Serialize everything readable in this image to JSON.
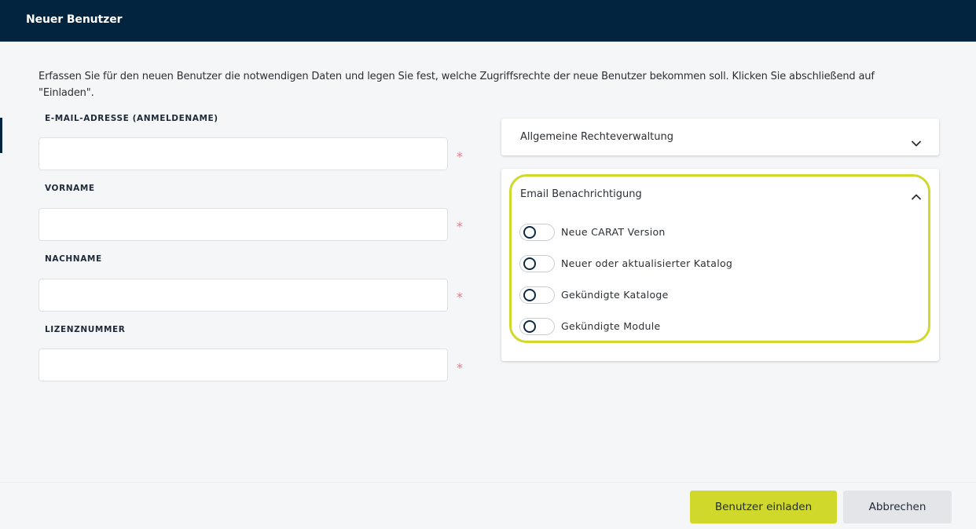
{
  "dialog": {
    "title": "Neuer Benutzer",
    "intro": "Erfassen Sie für den neuen Benutzer die notwendigen Daten und legen Sie fest, welche Zugriffsrechte der neue Benutzer bekommen soll. Klicken Sie abschließend auf \"Einladen\"."
  },
  "form": {
    "required_mark": "*",
    "email": {
      "label": "E-MAIL-ADRESSE (ANMELDENAME)",
      "value": ""
    },
    "firstname": {
      "label": "VORNAME",
      "value": ""
    },
    "lastname": {
      "label": "NACHNAME",
      "value": ""
    },
    "license": {
      "label": "LIZENZNUMMER",
      "value": ""
    }
  },
  "panels": {
    "general": {
      "title": "Allgemeine Rechteverwaltung",
      "expanded": false,
      "icon": "chevron-down-icon"
    },
    "email": {
      "title": "Email Benachrichtigung",
      "expanded": true,
      "icon": "chevron-up-icon",
      "highlight_color": "#cfd82b",
      "toggles": [
        {
          "label": "Neue CARAT Version",
          "on": false
        },
        {
          "label": "Neuer oder aktualisierter Katalog",
          "on": false
        },
        {
          "label": "Gekündigte Kataloge",
          "on": false
        },
        {
          "label": "Gekündigte Module",
          "on": false
        }
      ]
    }
  },
  "footer": {
    "invite_label": "Benutzer einladen",
    "cancel_label": "Abbrechen"
  },
  "colors": {
    "header_bg": "#03243f",
    "accent": "#cfd82b",
    "required": "#e07b8c"
  }
}
